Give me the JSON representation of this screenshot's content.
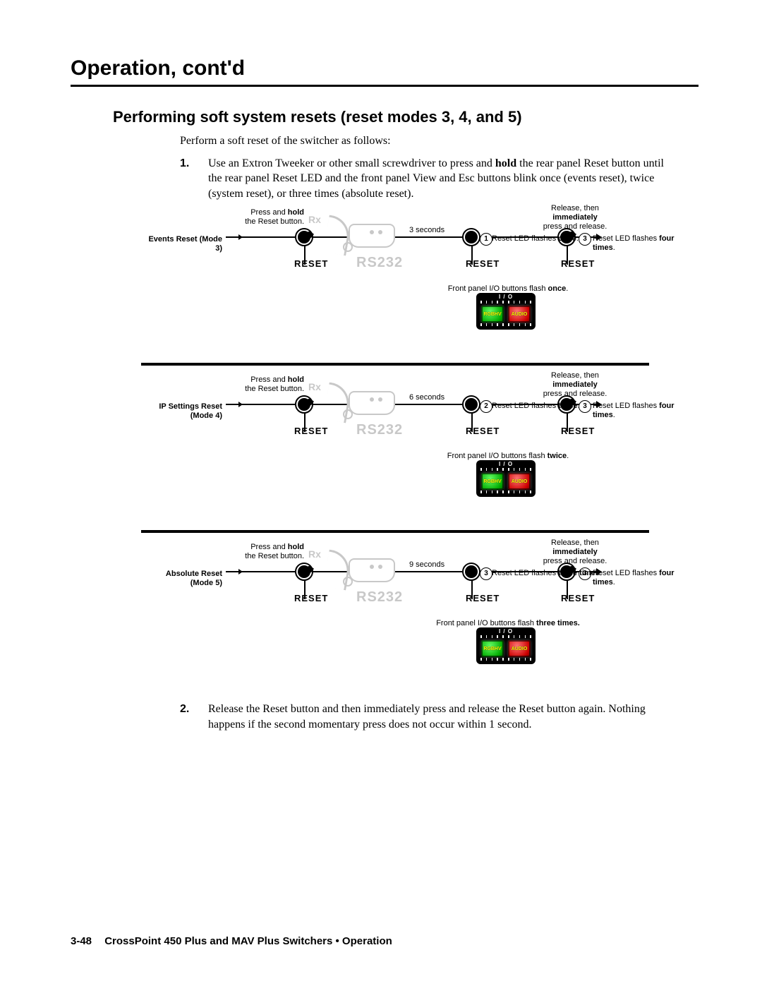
{
  "section_title": "Operation, cont'd",
  "subsection_title": "Performing soft system resets (reset modes 3, 4, and 5)",
  "intro": "Perform a soft reset of the switcher as follows:",
  "step1_num": "1.",
  "step1_pre": "Use an Extron Tweeker or other small screwdriver to press and ",
  "step1_bold": "hold",
  "step1_post": " the rear panel Reset button until the rear panel Reset LED and the front panel View and Esc buttons blink once (events reset), twice (system reset), or three times (absolute reset).",
  "step2_num": "2.",
  "step2_text": "Release the Reset button and then immediately press and release the Reset button again.  Nothing happens if the second momentary press does not occur within 1 second.",
  "common": {
    "press_pre": "Press and ",
    "press_bold": "hold",
    "press_post": "the Reset button.",
    "rx": "Rx",
    "rs232": "RS232",
    "reset": "RESET",
    "release_pre": "Release, then",
    "release_bold": "immediately",
    "release_post": "press and release.",
    "led_final_pre": "Reset LED flashes ",
    "led_final_bold": "four times",
    "led_final_post": ".",
    "io_label": "I / O",
    "btn_green": "RGBHV",
    "btn_red": "AUDIO"
  },
  "modes": [
    {
      "name": "Events Reset (Mode 3)",
      "seconds": "3 seconds",
      "count": "1",
      "led_pre": "Reset LED flashes ",
      "led_bold": "once",
      "led_post": ".",
      "flash_pre": "Front panel I/O buttons flash ",
      "flash_bold": "once",
      "flash_post": "."
    },
    {
      "name": "IP Settings Reset (Mode 4)",
      "seconds": "6 seconds",
      "count": "2",
      "led_pre": "Reset LED flashes ",
      "led_bold": "twice",
      "led_post": ".",
      "flash_pre": "Front panel I/O buttons flash ",
      "flash_bold": "twice",
      "flash_post": "."
    },
    {
      "name": "Absolute Reset (Mode 5)",
      "seconds": "9 seconds",
      "count": "3",
      "led_pre": "Reset LED flashes ",
      "led_bold": "three times",
      "led_post": ".",
      "flash_pre": "Front panel I/O buttons flash ",
      "flash_bold": "three times.",
      "flash_post": ""
    }
  ],
  "final_count": "3",
  "footer": {
    "page": "3-48",
    "text": "CrossPoint 450 Plus and MAV Plus Switchers • Operation"
  }
}
